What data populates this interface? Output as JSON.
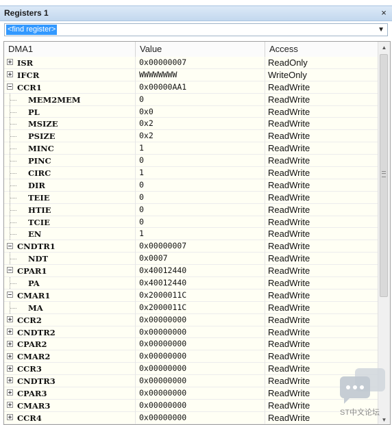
{
  "window": {
    "title": "Registers 1",
    "close_label": "×"
  },
  "finder": {
    "placeholder": "<find register>",
    "dropdown_arrow": "▼"
  },
  "table": {
    "columns": [
      "DMA1",
      "Value",
      "Access"
    ],
    "rows": [
      {
        "name": "ISR",
        "value": "0x00000007",
        "access": "ReadOnly",
        "level": 0,
        "expander": "plus"
      },
      {
        "name": "IFCR",
        "value": "WWWWWWWW",
        "access": "WriteOnly",
        "level": 0,
        "expander": "plus"
      },
      {
        "name": "CCR1",
        "value": "0x00000AA1",
        "access": "ReadWrite",
        "level": 0,
        "expander": "minus"
      },
      {
        "name": "MEM2MEM",
        "value": "0",
        "access": "ReadWrite",
        "level": 1
      },
      {
        "name": "PL",
        "value": "0x0",
        "access": "ReadWrite",
        "level": 1
      },
      {
        "name": "MSIZE",
        "value": "0x2",
        "access": "ReadWrite",
        "level": 1
      },
      {
        "name": "PSIZE",
        "value": "0x2",
        "access": "ReadWrite",
        "level": 1
      },
      {
        "name": "MINC",
        "value": "1",
        "access": "ReadWrite",
        "level": 1
      },
      {
        "name": "PINC",
        "value": "0",
        "access": "ReadWrite",
        "level": 1
      },
      {
        "name": "CIRC",
        "value": "1",
        "access": "ReadWrite",
        "level": 1
      },
      {
        "name": "DIR",
        "value": "0",
        "access": "ReadWrite",
        "level": 1
      },
      {
        "name": "TEIE",
        "value": "0",
        "access": "ReadWrite",
        "level": 1
      },
      {
        "name": "HTIE",
        "value": "0",
        "access": "ReadWrite",
        "level": 1
      },
      {
        "name": "TCIE",
        "value": "0",
        "access": "ReadWrite",
        "level": 1
      },
      {
        "name": "EN",
        "value": "1",
        "access": "ReadWrite",
        "level": 1
      },
      {
        "name": "CNDTR1",
        "value": "0x00000007",
        "access": "ReadWrite",
        "level": 0,
        "expander": "minus"
      },
      {
        "name": "NDT",
        "value": "0x0007",
        "access": "ReadWrite",
        "level": 1
      },
      {
        "name": "CPAR1",
        "value": "0x40012440",
        "access": "ReadWrite",
        "level": 0,
        "expander": "minus"
      },
      {
        "name": "PA",
        "value": "0x40012440",
        "access": "ReadWrite",
        "level": 1
      },
      {
        "name": "CMAR1",
        "value": "0x2000011C",
        "access": "ReadWrite",
        "level": 0,
        "expander": "minus"
      },
      {
        "name": "MA",
        "value": "0x2000011C",
        "access": "ReadWrite",
        "level": 1
      },
      {
        "name": "CCR2",
        "value": "0x00000000",
        "access": "ReadWrite",
        "level": 0,
        "expander": "plus"
      },
      {
        "name": "CNDTR2",
        "value": "0x00000000",
        "access": "ReadWrite",
        "level": 0,
        "expander": "plus"
      },
      {
        "name": "CPAR2",
        "value": "0x00000000",
        "access": "ReadWrite",
        "level": 0,
        "expander": "plus"
      },
      {
        "name": "CMAR2",
        "value": "0x00000000",
        "access": "ReadWrite",
        "level": 0,
        "expander": "plus"
      },
      {
        "name": "CCR3",
        "value": "0x00000000",
        "access": "ReadWrite",
        "level": 0,
        "expander": "plus"
      },
      {
        "name": "CNDTR3",
        "value": "0x00000000",
        "access": "ReadWrite",
        "level": 0,
        "expander": "plus"
      },
      {
        "name": "CPAR3",
        "value": "0x00000000",
        "access": "ReadWrite",
        "level": 0,
        "expander": "plus"
      },
      {
        "name": "CMAR3",
        "value": "0x00000000",
        "access": "ReadWrite",
        "level": 0,
        "expander": "plus"
      },
      {
        "name": "CCR4",
        "value": "0x00000000",
        "access": "ReadWrite",
        "level": 0,
        "expander": "plus"
      }
    ]
  },
  "scrollbar": {
    "up_arrow": "▲",
    "down_arrow": "▼"
  },
  "watermark": {
    "text": "ST中文论坛",
    "icon": "chat-bubble-icon"
  }
}
